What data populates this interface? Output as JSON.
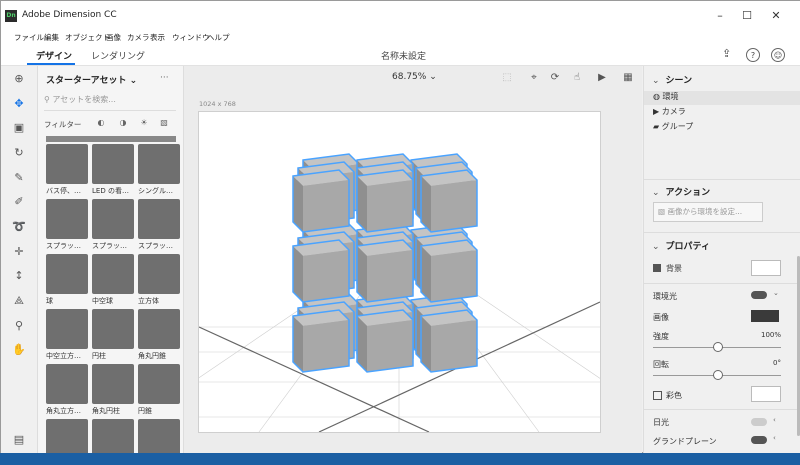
{
  "window": {
    "title": "Adobe Dimension CC",
    "app_icon": "Dn",
    "minimize": "–",
    "maximize": "☐",
    "close": "✕"
  },
  "menu": [
    "ファイル",
    "編集",
    "オブジェクト",
    "画像",
    "カメラ",
    "表示",
    "ウィンドウ",
    "ヘルプ"
  ],
  "tabs": {
    "design": "デザイン",
    "render": "レンダリング",
    "document_title": "名称未設定"
  },
  "tools": [
    "add-icon",
    "select-icon",
    "frame-icon",
    "orbit-icon",
    "magic-wand-icon",
    "sample-icon",
    "lasso-icon",
    "move-icon",
    "scale-icon",
    "perspective-icon",
    "zoom-icon",
    "hand-icon"
  ],
  "assets_panel": {
    "title": "スターターアセット",
    "search_placeholder": "アセットを検索...",
    "filter_label": "フィルター",
    "items": [
      {
        "label": "バス停、…"
      },
      {
        "label": "LED の看…"
      },
      {
        "label": "シングル…"
      },
      {
        "label": "スプラッ…"
      },
      {
        "label": "スプラッ…"
      },
      {
        "label": "スプラッ…"
      },
      {
        "label": "球"
      },
      {
        "label": "中空球"
      },
      {
        "label": "立方体"
      },
      {
        "label": "中空立方…"
      },
      {
        "label": "円柱"
      },
      {
        "label": "角丸円錐"
      },
      {
        "label": "角丸立方…"
      },
      {
        "label": "角丸円柱"
      },
      {
        "label": "円錐"
      },
      {
        "label": ""
      },
      {
        "label": ""
      },
      {
        "label": ""
      }
    ]
  },
  "viewport": {
    "zoom": "68.75%",
    "canvas_size": "1024 x 768"
  },
  "scene": {
    "title": "シーン",
    "items": [
      {
        "label": "環境",
        "icon": "environment-icon"
      },
      {
        "label": "カメラ",
        "icon": "camera-icon"
      },
      {
        "label": "グループ",
        "icon": "folder-icon"
      }
    ]
  },
  "actions": {
    "title": "アクション",
    "button": "画像から環境を設定..."
  },
  "properties": {
    "title": "プロパティ",
    "background": "背景",
    "env_light": "環境光",
    "image": "画像",
    "intensity": "強度",
    "intensity_value": "100%",
    "intensity_fraction": 0.5,
    "rotation": "回転",
    "rotation_value": "0°",
    "rotation_fraction": 0.5,
    "tint": "彩色",
    "sunlight": "日光",
    "ground_plane": "グランドプレーン"
  },
  "colors": {
    "accent": "#1473e6",
    "cube": "#a8a8a8",
    "selection": "#4aa3ff"
  }
}
